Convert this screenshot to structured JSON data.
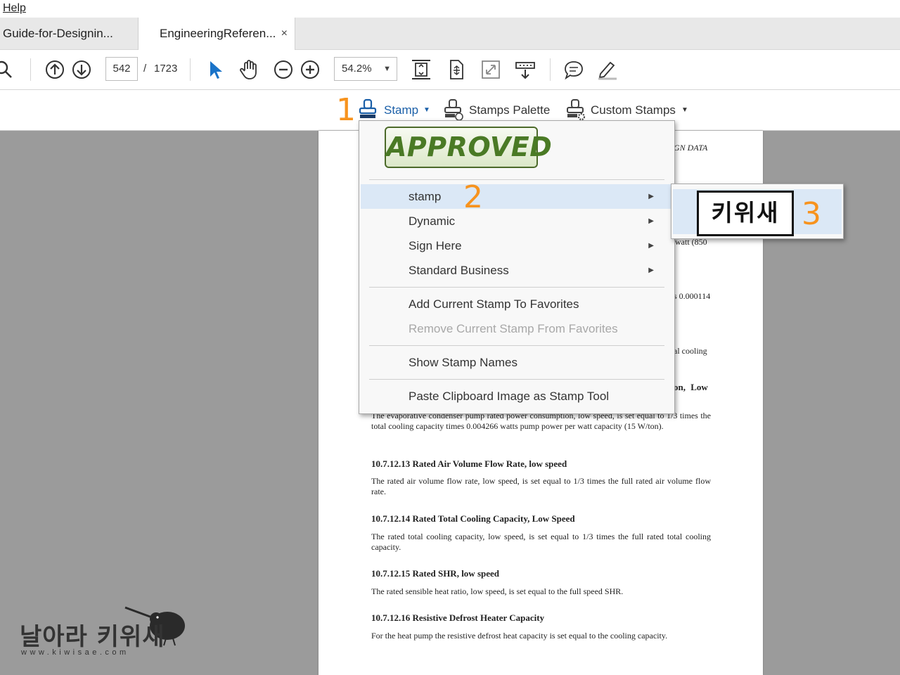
{
  "menubar": {
    "help": "Help"
  },
  "tabs": [
    {
      "label": "Guide-for-Designin..."
    },
    {
      "label": "EngineeringReferen...",
      "close": "×"
    }
  ],
  "toolbar": {
    "page_current": "542",
    "page_sep": "/",
    "page_total": "1723",
    "zoom": "54.2%",
    "icons": [
      "search-icon",
      "page-up-icon",
      "page-down-icon",
      "select-arrow-icon",
      "hand-icon",
      "zoom-out-icon",
      "zoom-in-icon",
      "fit-page-icon",
      "rotate-icon",
      "full-screen-icon",
      "read-mode-icon",
      "comment-icon",
      "highlight-pen-icon"
    ]
  },
  "stampbar": {
    "stamp": "Stamp",
    "palette": "Stamps Palette",
    "custom": "Custom Stamps"
  },
  "annotations": {
    "a1": "1",
    "a2": "2",
    "a3": "3"
  },
  "stamp_menu": {
    "approved": "APPROVED",
    "items": [
      {
        "label": "stamp",
        "submenu": true,
        "highlighted": true
      },
      {
        "label": "Dynamic",
        "submenu": true
      },
      {
        "label": "Sign Here",
        "submenu": true
      },
      {
        "label": "Standard Business",
        "submenu": true
      }
    ],
    "favorites_add": "Add Current Stamp To Favorites",
    "favorites_remove": "Remove Current Stamp From Favorites",
    "show_names": "Show Stamp Names",
    "paste": "Paste Clipboard Image as Stamp Tool",
    "submenu_arrow": "▶"
  },
  "submenu": {
    "stamp_text": "키위새"
  },
  "document": {
    "frag_top": "GN DATA",
    "frag_watt": "watt (850",
    "frag_000114": "s 0.000114",
    "frag_cooling": "al cooling",
    "frag_low": "on, Low",
    "p_pump": "The evaporative condenser pump rated power consumption, low speed, is set equal to 1/3 times the total cooling capacity times 0.004266 watts pump power per watt capacity (15 W/ton).",
    "h13": "10.7.12.13   Rated Air Volume Flow Rate, low speed",
    "p13": "The rated air volume flow rate, low speed, is set equal to 1/3 times the full rated air volume flow rate.",
    "h14": "10.7.12.14   Rated Total Cooling Capacity, Low Speed",
    "p14": "The rated total cooling capacity, low speed, is set equal to 1/3 times the full rated total cooling capacity.",
    "h15": "10.7.12.15   Rated SHR, low speed",
    "p15": "The rated sensible heat ratio, low speed, is set equal to the full speed SHR.",
    "h16": "10.7.12.16   Resistive Defrost Heater Capacity",
    "p16": "For the heat pump the resistive defrost heat capacity is set equal to the cooling capacity."
  },
  "watermark": {
    "text": "날아라 키위새",
    "url": "www.kiwisae.com"
  },
  "colors": {
    "annotation": "#f7931e",
    "highlight": "#dbe8f6",
    "accent_blue": "#1a73c8"
  }
}
